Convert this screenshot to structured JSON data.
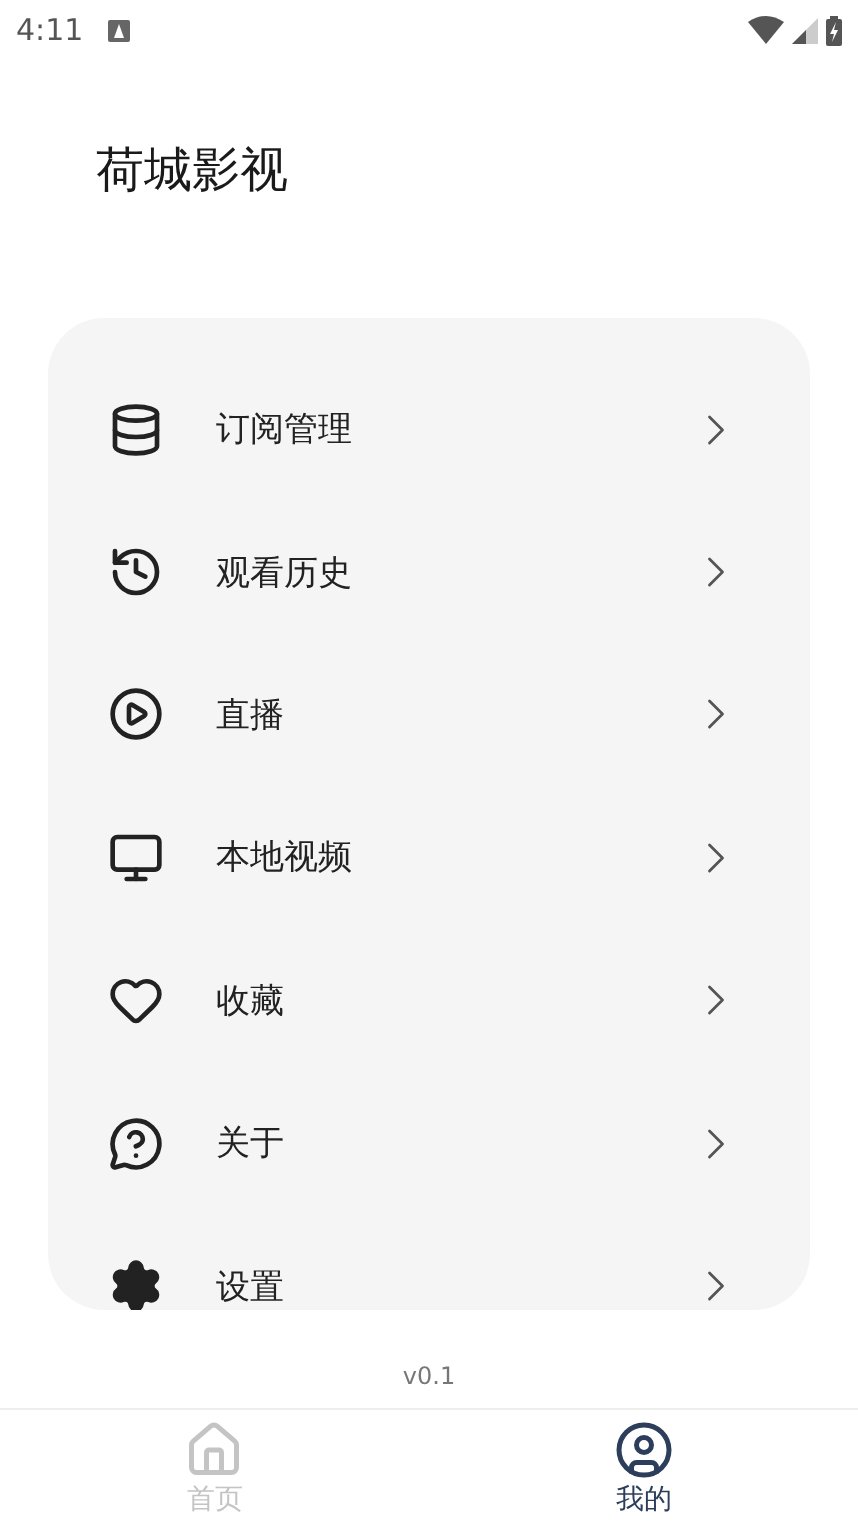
{
  "status_bar": {
    "time": "4:11"
  },
  "title": "荷城影视",
  "menu": [
    {
      "kind": "database",
      "label": "订阅管理"
    },
    {
      "kind": "history",
      "label": "观看历史"
    },
    {
      "kind": "play",
      "label": "直播"
    },
    {
      "kind": "monitor",
      "label": "本地视频"
    },
    {
      "kind": "heart",
      "label": "收藏"
    },
    {
      "kind": "help",
      "label": "关于"
    },
    {
      "kind": "settings",
      "label": "设置"
    }
  ],
  "version": "v0.1",
  "bottom_nav": [
    {
      "kind": "home",
      "label": "首页",
      "selected": false
    },
    {
      "kind": "user",
      "label": "我的",
      "selected": true
    }
  ]
}
